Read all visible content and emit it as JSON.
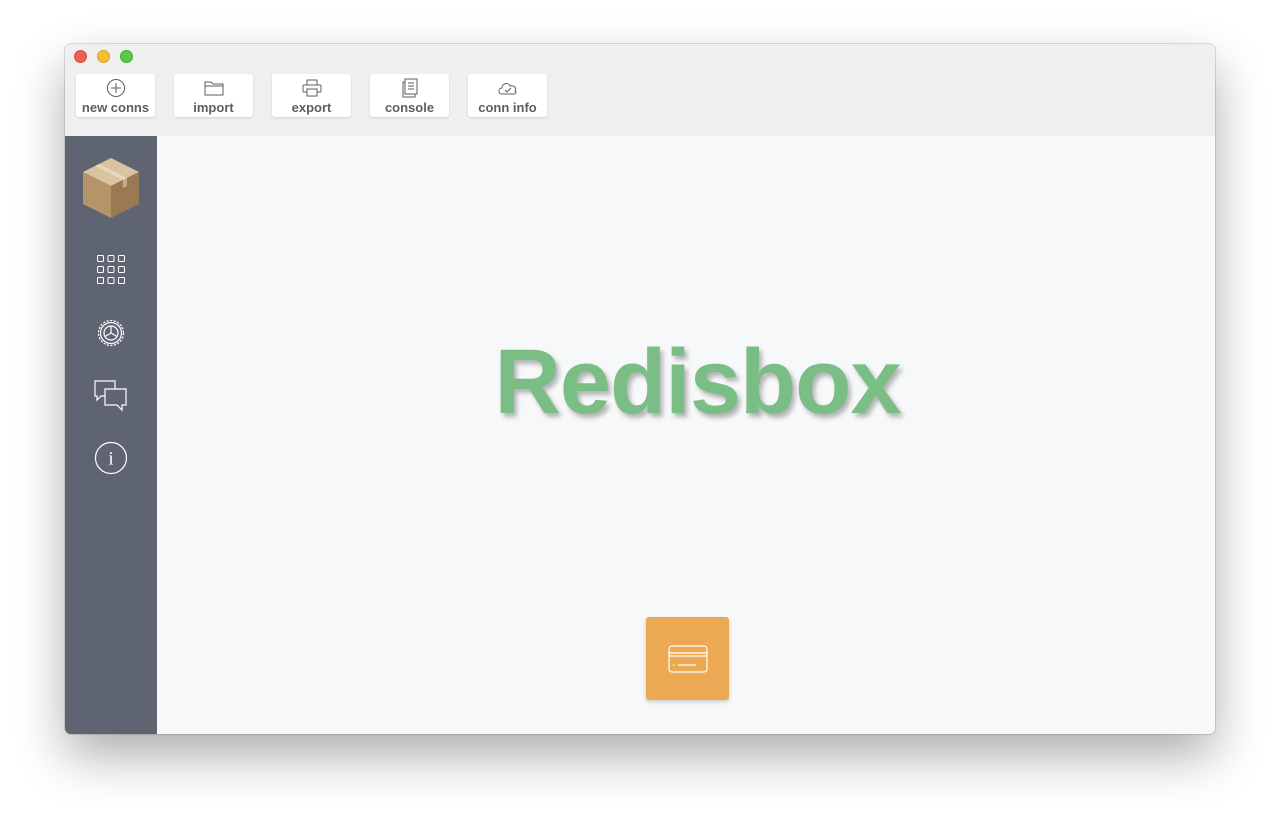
{
  "window": {
    "traffic_lights": [
      "close",
      "minimize",
      "maximize"
    ]
  },
  "toolbar": {
    "buttons": [
      {
        "label": "new conns",
        "icon": "plus-circle-icon"
      },
      {
        "label": "import",
        "icon": "folder-icon"
      },
      {
        "label": "export",
        "icon": "printer-icon"
      },
      {
        "label": "console",
        "icon": "document-icon"
      },
      {
        "label": "conn info",
        "icon": "cloud-check-icon"
      }
    ]
  },
  "sidebar": {
    "logo": "box-logo-icon",
    "items": [
      {
        "icon": "grid-icon"
      },
      {
        "icon": "gear-icon"
      },
      {
        "icon": "chat-bubbles-icon"
      },
      {
        "icon": "info-icon"
      }
    ]
  },
  "main": {
    "title": "Redisbox",
    "action_icon": "card-icon"
  },
  "colors": {
    "sidebar_bg": "#5f6473",
    "brand_green": "#7bbe85",
    "action_orange": "#eba953",
    "toolbar_bg": "#efefef",
    "content_bg": "#f7f8fa"
  }
}
